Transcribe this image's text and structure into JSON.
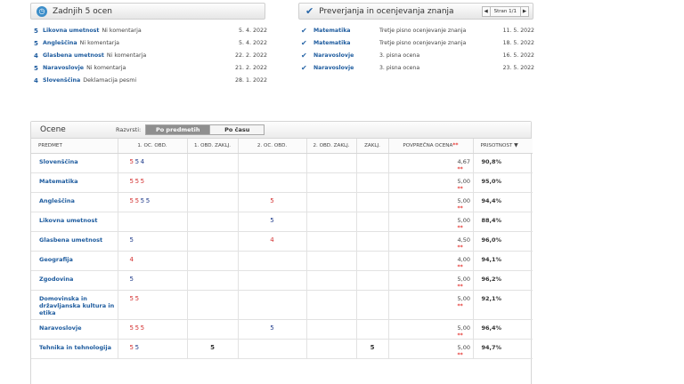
{
  "recent": {
    "title": "Zadnjih 5 ocen",
    "items": [
      {
        "grade": "5",
        "grade_color": "#1d5b9e",
        "subject": "Likovna umetnost",
        "comment": "Ni komentarja",
        "date": "5. 4. 2022"
      },
      {
        "grade": "5",
        "grade_color": "#1d5b9e",
        "subject": "Angleščina",
        "comment": "Ni komentarja",
        "date": "5. 4. 2022"
      },
      {
        "grade": "4",
        "grade_color": "#1d5b9e",
        "subject": "Glasbena umetnost",
        "comment": "Ni komentarja",
        "date": "22. 2. 2022"
      },
      {
        "grade": "5",
        "grade_color": "#1d5b9e",
        "subject": "Naravoslovje",
        "comment": "Ni komentarja",
        "date": "21. 2. 2022"
      },
      {
        "grade": "4",
        "grade_color": "#1d5b9e",
        "subject": "Slovenščina",
        "comment": "Deklamacija pesmi",
        "date": "28. 1. 2022"
      }
    ]
  },
  "tests": {
    "title": "Preverjanja in ocenjevanja znanja",
    "pager": {
      "prev": "◀",
      "label": "Stran 1/1",
      "next": "▶"
    },
    "items": [
      {
        "icon": "✔",
        "subject": "Matematika",
        "desc": "Tretje pisno ocenjevanje znanja",
        "date": "11. 5. 2022"
      },
      {
        "icon": "✔",
        "subject": "Matematika",
        "desc": "Tretje pisno ocenjevanje znanja",
        "date": "18. 5. 2022"
      },
      {
        "icon": "✔",
        "subject": "Naravoslovje",
        "desc": "3. pisna ocena",
        "date": "16. 5. 2022"
      },
      {
        "icon": "✔",
        "subject": "Naravoslovje",
        "desc": "3. pisna ocena",
        "date": "23. 5. 2022"
      }
    ]
  },
  "grades": {
    "title": "Ocene",
    "sort_label": "Razvrsti:",
    "sort_by_subject": "Po predmetih",
    "sort_by_time": "Po času",
    "columns": [
      "PREDMET",
      "1. OC. OBD.",
      "1. OBD. ZAKLJ.",
      "2. OC. OBD.",
      "2. OBD. ZAKLJ.",
      "ZAKLJ.",
      "POVPREČNA OCENA",
      "PRISOTNOST"
    ],
    "avg_stars": "**",
    "sort_arrow": "▼",
    "rows": [
      {
        "subject": "Slovenščina",
        "p1": [
          {
            "v": "5",
            "c": "#d32f2f"
          },
          {
            "v": "5",
            "c": "#1e3a8a"
          },
          {
            "v": "4",
            "c": "#1e3a8a"
          }
        ],
        "p1z": "",
        "p2": [],
        "p2z": "",
        "final": "",
        "avg": "4,67",
        "att": "90,8%"
      },
      {
        "subject": "Matematika",
        "p1": [
          {
            "v": "5",
            "c": "#d32f2f"
          },
          {
            "v": "5",
            "c": "#d32f2f"
          },
          {
            "v": "5",
            "c": "#d32f2f"
          }
        ],
        "p1z": "",
        "p2": [],
        "p2z": "",
        "final": "",
        "avg": "5,00",
        "att": "95,0%"
      },
      {
        "subject": "Angleščina",
        "p1": [
          {
            "v": "5",
            "c": "#d32f2f"
          },
          {
            "v": "5",
            "c": "#d32f2f"
          },
          {
            "v": "5",
            "c": "#1e3a8a"
          },
          {
            "v": "5",
            "c": "#1e3a8a"
          }
        ],
        "p1z": "",
        "p2": [
          {
            "v": "5",
            "c": "#d32f2f"
          }
        ],
        "p2z": "",
        "final": "",
        "avg": "5,00",
        "att": "94,4%"
      },
      {
        "subject": "Likovna umetnost",
        "p1": [],
        "p1z": "",
        "p2": [
          {
            "v": "5",
            "c": "#1e3a8a"
          }
        ],
        "p2z": "",
        "final": "",
        "avg": "5,00",
        "att": "88,4%"
      },
      {
        "subject": "Glasbena umetnost",
        "p1": [
          {
            "v": "5",
            "c": "#1e3a8a"
          }
        ],
        "p1z": "",
        "p2": [
          {
            "v": "4",
            "c": "#d32f2f"
          }
        ],
        "p2z": "",
        "final": "",
        "avg": "4,50",
        "att": "96,0%"
      },
      {
        "subject": "Geografija",
        "p1": [
          {
            "v": "4",
            "c": "#d32f2f"
          }
        ],
        "p1z": "",
        "p2": [],
        "p2z": "",
        "final": "",
        "avg": "4,00",
        "att": "94,1%"
      },
      {
        "subject": "Zgodovina",
        "p1": [
          {
            "v": "5",
            "c": "#1e3a8a"
          }
        ],
        "p1z": "",
        "p2": [],
        "p2z": "",
        "final": "",
        "avg": "5,00",
        "att": "96,2%"
      },
      {
        "subject": "Domovinska in državljanska kultura in etika",
        "p1": [
          {
            "v": "5",
            "c": "#d32f2f"
          },
          {
            "v": "5",
            "c": "#d32f2f"
          }
        ],
        "p1z": "",
        "p2": [],
        "p2z": "",
        "final": "",
        "avg": "5,00",
        "att": "92,1%"
      },
      {
        "subject": "Naravoslovje",
        "p1": [
          {
            "v": "5",
            "c": "#d32f2f"
          },
          {
            "v": "5",
            "c": "#d32f2f"
          },
          {
            "v": "5",
            "c": "#d32f2f"
          }
        ],
        "p1z": "",
        "p2": [
          {
            "v": "5",
            "c": "#1e3a8a"
          }
        ],
        "p2z": "",
        "final": "",
        "avg": "5,00",
        "att": "96,4%"
      },
      {
        "subject": "Tehnika in tehnologija",
        "p1": [
          {
            "v": "5",
            "c": "#d32f2f"
          },
          {
            "v": "5",
            "c": "#1e3a8a"
          }
        ],
        "p1z": "5",
        "p2": [],
        "p2z": "",
        "final": "5",
        "avg": "5,00",
        "att": "94,7%"
      }
    ]
  }
}
